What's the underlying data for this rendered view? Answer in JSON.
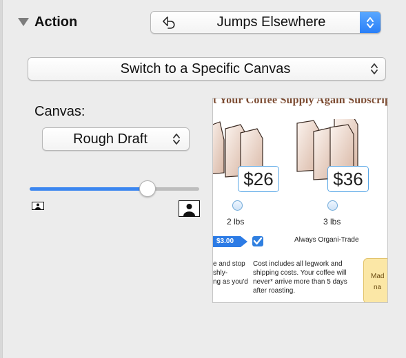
{
  "section": {
    "title": "Action"
  },
  "action_popup": {
    "value": "Jumps Elsewhere",
    "icon": "jump-arrow-icon"
  },
  "target_popup": {
    "value": "Switch to a Specific Canvas"
  },
  "canvas": {
    "label": "Canvas:",
    "value": "Rough Draft"
  },
  "zoom_slider": {
    "level": 0.69
  },
  "preview": {
    "headline": "t Your Coffee Supply Again  Subscripti",
    "prices": [
      "$26",
      "$36"
    ],
    "weights": [
      "2 lbs",
      "3 lbs"
    ],
    "discount": "$3.00",
    "checkbox_label": "Always Organi-Trade",
    "left_text": [
      "e and stop",
      "shly-",
      "ng as you'd"
    ],
    "right_text": [
      "Cost includes all legwork and",
      "shipping costs. Your coffee will",
      "never* arrive more than 5 days",
      "after roasting."
    ],
    "badge_text": [
      "Mad",
      "na"
    ]
  },
  "colors": {
    "accent": "#3b86f0",
    "background": "#ececec"
  }
}
